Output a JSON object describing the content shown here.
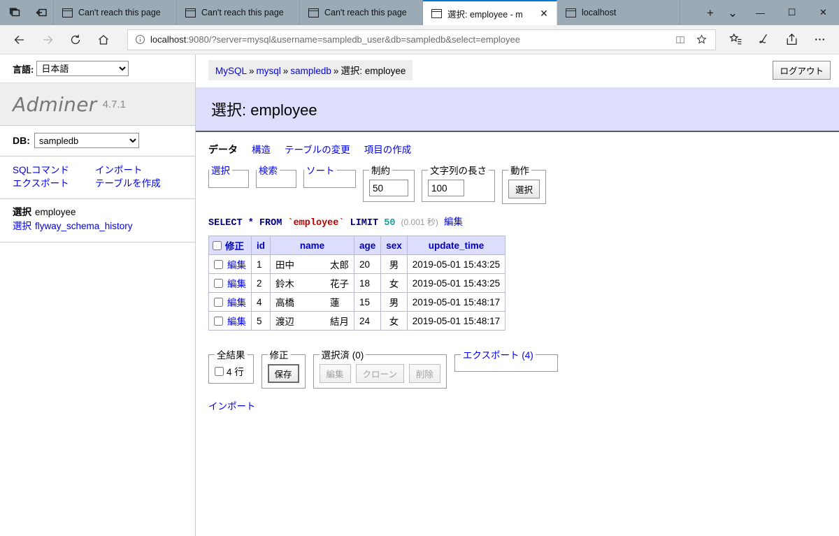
{
  "browser": {
    "tabs": [
      {
        "title": "Can't reach this page",
        "active": false
      },
      {
        "title": "Can't reach this page",
        "active": false
      },
      {
        "title": "Can't reach this page",
        "active": false
      },
      {
        "title": "選択: employee - m",
        "active": true
      },
      {
        "title": "localhost",
        "active": false
      }
    ],
    "new_tab_label": "+",
    "tab_list_chevron": "⌄",
    "window_controls": {
      "minimize": "—",
      "maximize": "☐",
      "close": "✕"
    },
    "close_tab_label": "✕",
    "nav": {
      "back": "←",
      "forward": "→",
      "refresh": "↻",
      "home": "⌂"
    },
    "url": {
      "host": "localhost",
      "rest": ":9080/?server=mysql&username=sampledb_user&db=sampledb&select=employee"
    },
    "url_actions": {
      "reading_view": "book-icon",
      "favorite": "☆"
    },
    "toolbar_icons": [
      "favorites-hub-icon",
      "web-note-icon",
      "share-icon",
      "settings-more-icon"
    ]
  },
  "sidebar": {
    "language_label": "言語:",
    "language_value": "日本語",
    "logo": "Adminer",
    "version": "4.7.1",
    "db_label": "DB:",
    "db_value": "sampledb",
    "links": [
      {
        "label": "SQLコマンド"
      },
      {
        "label": "インポート"
      },
      {
        "label": "エクスポート"
      },
      {
        "label": "テーブルを作成"
      }
    ],
    "tables": [
      {
        "select_label": "選択",
        "name": "employee",
        "active": true
      },
      {
        "select_label": "選択",
        "name": "flyway_schema_history",
        "active": false
      }
    ]
  },
  "header": {
    "breadcrumb": [
      {
        "label": "MySQL",
        "link": true
      },
      {
        "label": "mysql",
        "link": true
      },
      {
        "label": "sampledb",
        "link": true
      },
      {
        "label": "選択: employee",
        "link": false
      }
    ],
    "breadcrumb_separator": "»",
    "logout_label": "ログアウト",
    "page_title": "選択: employee"
  },
  "tabs": [
    {
      "label": "データ",
      "active": true
    },
    {
      "label": "構造",
      "active": false
    },
    {
      "label": "テーブルの変更",
      "active": false
    },
    {
      "label": "項目の作成",
      "active": false
    }
  ],
  "query_fieldsets": {
    "select_legend": "選択",
    "search_legend": "検索",
    "sort_legend": "ソート",
    "limit_legend": "制約",
    "limit_value": "50",
    "text_length_legend": "文字列の長さ",
    "text_length_value": "100",
    "action_legend": "動作",
    "action_button": "選択"
  },
  "sql": {
    "keyword_select": "SELECT",
    "star": "*",
    "keyword_from": "FROM",
    "table": "employee",
    "keyword_limit": "LIMIT",
    "limit": "50",
    "duration": "(0.001 秒)",
    "edit_link": "編集"
  },
  "table": {
    "columns": [
      "修正",
      "id",
      "name",
      "age",
      "sex",
      "update_time"
    ],
    "edit_label": "編集",
    "rows": [
      {
        "edit": "編集",
        "id": "1",
        "name_last": "田中",
        "name_first": "太郎",
        "age": "20",
        "sex": "男",
        "update_time": "2019-05-01 15:43:25"
      },
      {
        "edit": "編集",
        "id": "2",
        "name_last": "鈴木",
        "name_first": "花子",
        "age": "18",
        "sex": "女",
        "update_time": "2019-05-01 15:43:25"
      },
      {
        "edit": "編集",
        "id": "4",
        "name_last": "高橋",
        "name_first": "蓮",
        "age": "15",
        "sex": "男",
        "update_time": "2019-05-01 15:48:17"
      },
      {
        "edit": "編集",
        "id": "5",
        "name_last": "渡辺",
        "name_first": "結月",
        "age": "24",
        "sex": "女",
        "update_time": "2019-05-01 15:48:17"
      }
    ]
  },
  "footer": {
    "all_results_legend": "全結果",
    "rows_count_label": "4 行",
    "modify_legend": "修正",
    "save_label": "保存",
    "selected_legend": "選択済 (0)",
    "selected_buttons": [
      "編集",
      "クローン",
      "削除"
    ],
    "export_legend": "エクスポート (4)",
    "import_link": "インポート"
  },
  "colors": {
    "accent_header": "#ddddfc",
    "link": "#0000ee",
    "chrome_titlebar": "#9babb5",
    "active_tab_underline": "#0078d7",
    "sql_keyword": "#000080",
    "sql_table": "#c00000"
  }
}
